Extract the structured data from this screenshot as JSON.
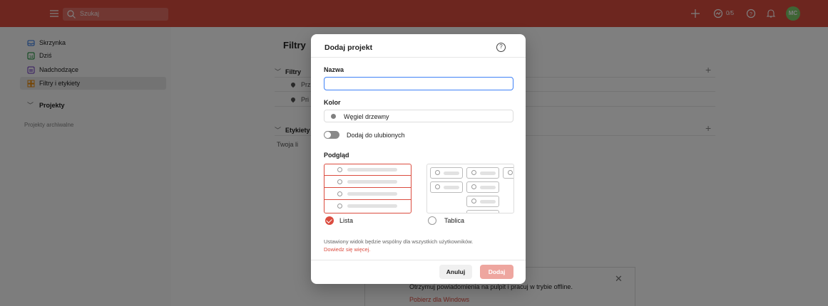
{
  "topbar": {
    "search_placeholder": "Szukaj",
    "karma": "0/5",
    "avatar_initials": "MC",
    "color": "#db4c3f"
  },
  "sidebar": {
    "items": [
      {
        "label": "Skrzynka",
        "icon": "inbox-icon"
      },
      {
        "label": "Dziś",
        "icon": "calendar-today-icon"
      },
      {
        "label": "Nadchodzące",
        "icon": "calendar-upcoming-icon"
      },
      {
        "label": "Filtry i etykiety",
        "icon": "filters-labels-icon",
        "selected": true
      }
    ],
    "projects_label": "Projekty",
    "archived_label": "Projekty archiwalne"
  },
  "main": {
    "title": "Filtry",
    "filters_section": "Filtry",
    "filter_rows": [
      "Prz",
      "Pri"
    ],
    "labels_section": "Etykiety",
    "labels_desc": "Twoja li"
  },
  "toast": {
    "message": "Otrzymuj powiadomienia na pulpit i pracuj w trybie offline.",
    "link": "Pobierz dla Windows"
  },
  "modal": {
    "title": "Dodaj projekt",
    "name_label": "Nazwa",
    "name_value": "",
    "color_label": "Kolor",
    "color_value": "Węgiel drzewny",
    "favorite_label": "Dodaj do ulubionych",
    "preview_label": "Podgląd",
    "view_list": "Lista",
    "view_board": "Tablica",
    "note": "Ustawiony widok będzie wspólny dla wszystkich użytkowników.",
    "learn_more": "Dowiedz się więcej.",
    "cancel": "Anuluj",
    "add": "Dodaj"
  }
}
